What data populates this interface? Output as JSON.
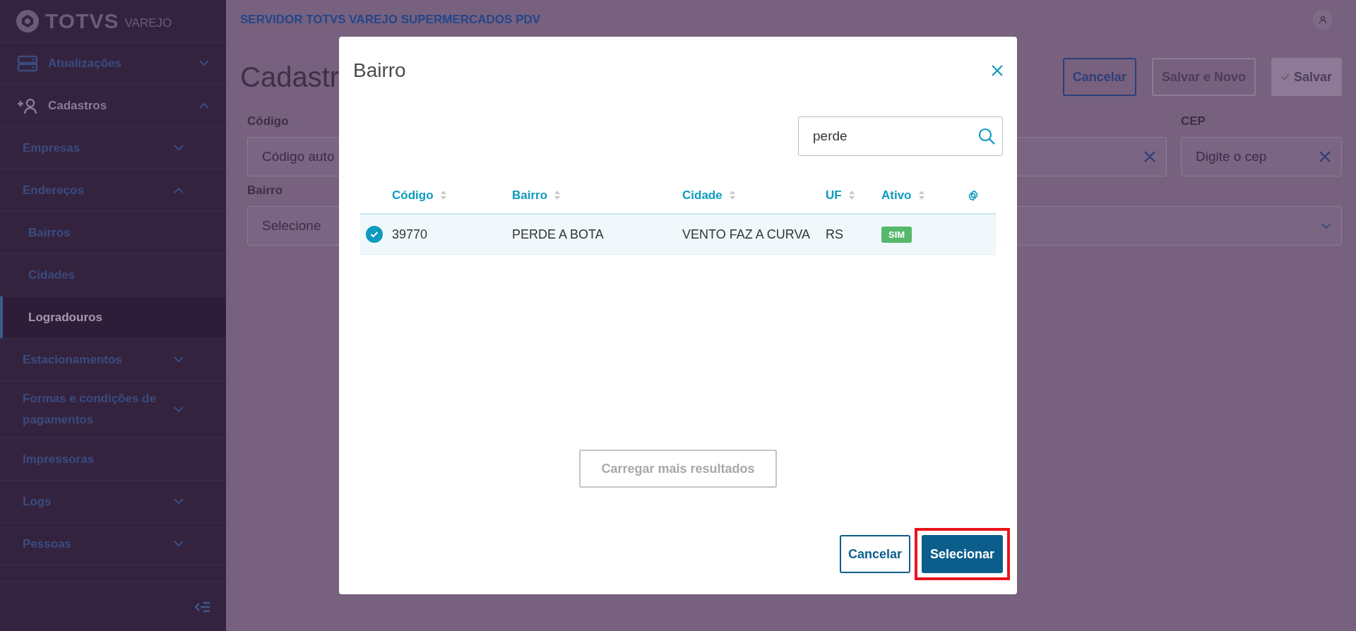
{
  "app": {
    "logo": "TOTVS",
    "logo_sub": "VAREJO",
    "header_title": "SERVIDOR TOTVS VAREJO SUPERMERCADOS PDV"
  },
  "sidebar": {
    "items": [
      {
        "label": "Atualizações",
        "expanded": false,
        "selected": false
      },
      {
        "label": "Cadastros",
        "expanded": true,
        "selected": false,
        "children": [
          {
            "label": "Empresas",
            "expanded": false,
            "selected": false
          },
          {
            "label": "Endereços",
            "expanded": true,
            "selected": false,
            "children": [
              {
                "label": "Bairros",
                "selected": false
              },
              {
                "label": "Cidades",
                "selected": false
              },
              {
                "label": "Logradouros",
                "selected": true
              }
            ]
          },
          {
            "label": "Estacionamentos",
            "expanded": false,
            "selected": false
          },
          {
            "label": "Formas e condições de pagamentos",
            "expanded": false,
            "selected": false
          },
          {
            "label": "Impressoras",
            "selected": false
          },
          {
            "label": "Logs",
            "expanded": false,
            "selected": false
          },
          {
            "label": "Pessoas",
            "expanded": false,
            "selected": false
          }
        ]
      }
    ]
  },
  "page": {
    "title": "Cadastr",
    "actions": [
      {
        "label": "Cancelar",
        "kind": "outline"
      },
      {
        "label": "Salvar e Novo",
        "kind": "disabled"
      },
      {
        "label": "Salvar",
        "kind": "primary"
      }
    ],
    "fields": [
      {
        "label": "Código",
        "placeholder": "Código auto",
        "kind": "text"
      },
      {
        "kind": "text",
        "clearable": true
      },
      {
        "label": "CEP",
        "placeholder": "Digite o cep",
        "kind": "text",
        "clearable": true
      },
      {
        "label": "Bairro",
        "placeholder": "Selecione",
        "kind": "select"
      }
    ]
  },
  "dialog": {
    "title": "Bairro",
    "search": {
      "value": "perde"
    },
    "table": {
      "columns": [
        "Código",
        "Bairro",
        "Cidade",
        "UF",
        "Ativo"
      ],
      "rows": [
        {
          "selected": true,
          "cells": [
            "39770",
            "PERDE A BOTA",
            "VENTO FAZ A CURVA",
            "RS"
          ],
          "status": "SIM"
        }
      ]
    },
    "load_more": {
      "label": "Carregar mais resultados",
      "disabled": true
    },
    "buttons": [
      {
        "label": "Cancelar",
        "kind": "outline",
        "highlighted": false
      },
      {
        "label": "Selecionar",
        "kind": "primary",
        "highlighted": true
      }
    ]
  }
}
